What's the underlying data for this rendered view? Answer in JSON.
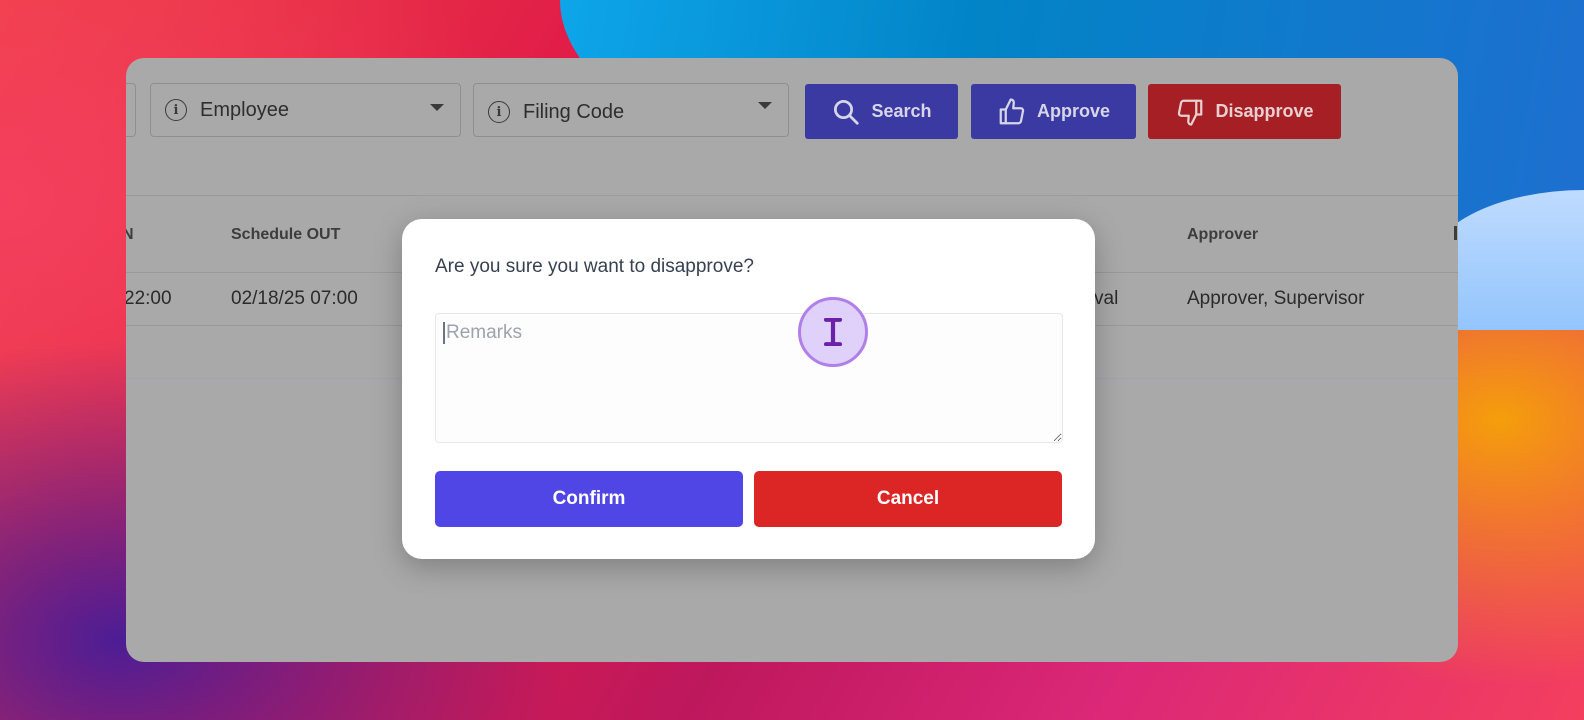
{
  "filters": {
    "employee_label": "Employee",
    "filing_code_label": "Filing Code"
  },
  "toolbar": {
    "search_label": "Search",
    "approve_label": "Approve",
    "disapprove_label": "Disapprove"
  },
  "table": {
    "columns": {
      "schedule_in_partial": "N",
      "schedule_out": "Schedule OUT",
      "approver": "Approver"
    },
    "rows": [
      {
        "schedule_in_partial": "22:00",
        "schedule_out": "02/18/25 07:00",
        "status_partial": "val",
        "approver": "Approver, Supervisor"
      }
    ]
  },
  "modal": {
    "title": "Are you sure you want to disapprove?",
    "remarks_placeholder": "Remarks",
    "remarks_value": "",
    "confirm_label": "Confirm",
    "cancel_label": "Cancel"
  },
  "colors": {
    "confirm": "#4f46e5",
    "cancel": "#dc2626",
    "toolbar_blue": "#3b3aa3",
    "toolbar_red": "#a61f24"
  },
  "icons": [
    "info-icon",
    "chevron-down-icon",
    "search-icon",
    "thumbs-up-icon",
    "thumbs-down-icon",
    "text-cursor-icon"
  ]
}
